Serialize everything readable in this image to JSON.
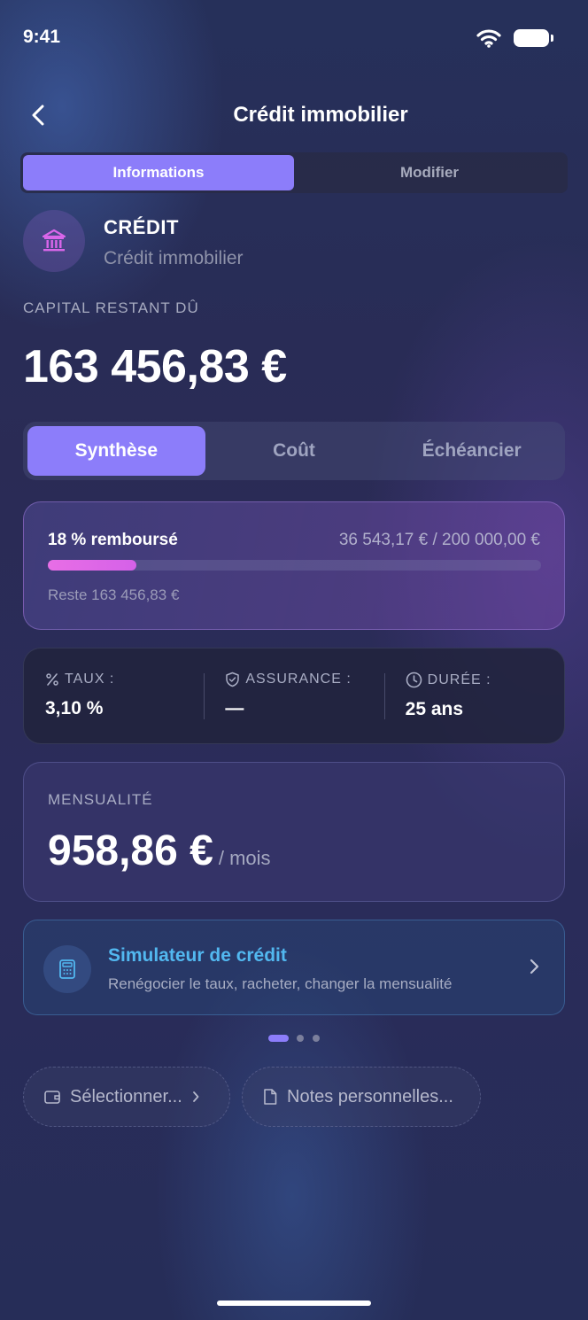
{
  "status_bar": {
    "time": "9:41"
  },
  "header": {
    "title": "Crédit immobilier"
  },
  "top_tabs": [
    {
      "label": "Informations",
      "active": true
    },
    {
      "label": "Modifier",
      "active": false
    }
  ],
  "account": {
    "type": "CRÉDIT",
    "name": "Crédit immobilier",
    "icon": "bank-icon"
  },
  "capital": {
    "label": "CAPITAL RESTANT DÛ",
    "value": "163 456,83 €"
  },
  "main_tabs": [
    {
      "label": "Synthèse",
      "active": true
    },
    {
      "label": "Coût",
      "active": false
    },
    {
      "label": "Échéancier",
      "active": false
    }
  ],
  "progress": {
    "label": "18 % remboursé",
    "amounts": "36 543,17 € / 200 000,00 €",
    "fraction": 0.18,
    "remaining": "Reste 163 456,83 €"
  },
  "stats": {
    "rate": {
      "label": "TAUX :",
      "value": "3,10 %"
    },
    "insurance": {
      "label": "ASSURANCE :",
      "value": "—"
    },
    "duration": {
      "label": "DURÉE :",
      "value": "25 ans"
    }
  },
  "monthly": {
    "label": "MENSUALITÉ",
    "value": "958,86 €",
    "unit": "/ mois"
  },
  "simulator": {
    "title": "Simulateur de crédit",
    "subtitle": "Renégocier le taux, racheter, changer la mensualité"
  },
  "chips": {
    "select": "Sélectionner...",
    "notes": "Notes personnelles..."
  },
  "colors": {
    "accent": "#8c7dfa",
    "progress": "#e86ee6",
    "simulator": "#52b8f0"
  }
}
